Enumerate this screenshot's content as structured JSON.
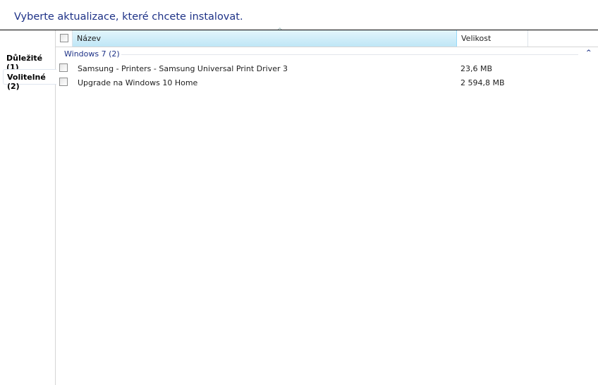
{
  "title": "Vyberte aktualizace, které chcete instalovat.",
  "tabs": [
    {
      "label": "Důležité (1)"
    },
    {
      "label": "Volitelné (2)",
      "selected": true
    }
  ],
  "columns": {
    "name": "Název",
    "size": "Velikost"
  },
  "group": {
    "label": "Windows 7 (2)"
  },
  "updates": [
    {
      "name": "Samsung - Printers - Samsung Universal Print Driver 3",
      "size": "23,6 MB",
      "checked": false
    },
    {
      "name": "Upgrade na Windows 10 Home",
      "size": "2 594,8 MB",
      "checked": false
    }
  ]
}
